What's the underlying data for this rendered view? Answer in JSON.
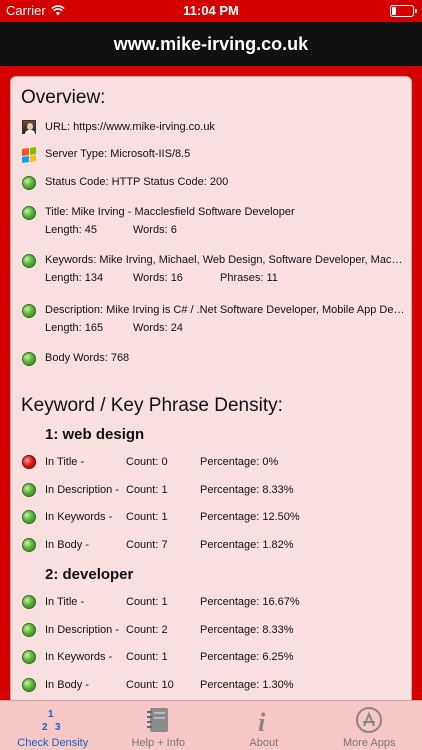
{
  "status_bar": {
    "carrier": "Carrier",
    "time": "11:04 PM",
    "battery_level": 0.22
  },
  "nav": {
    "title": "www.mike-irving.co.uk"
  },
  "overview": {
    "heading": "Overview:",
    "url": "URL: https://www.mike-irving.co.uk",
    "server": "Server Type: Microsoft-IIS/8.5",
    "status": "Status Code: HTTP Status Code: 200",
    "title": {
      "text": "Title: Mike Irving - Macclesfield Software Developer",
      "length": "Length: 45",
      "words": "Words: 6"
    },
    "keywords": {
      "text": "Keywords: Mike Irving, Michael, Web Design, Software Developer, Macclesfield, Cheshire",
      "length": "Length: 134",
      "words": "Words: 16",
      "phrases": "Phrases: 11"
    },
    "description": {
      "text": "Description: Mike Irving is C# / .Net Software Developer, Mobile App Developer in Macclesfield",
      "length": "Length: 165",
      "words": "Words: 24"
    },
    "body_words": "Body Words: 768"
  },
  "density": {
    "heading": "Keyword / Key Phrase Density:",
    "groups": [
      {
        "title": "1: web design",
        "rows": [
          {
            "label": "In Title -",
            "count": "Count: 0",
            "percentage": "Percentage: 0%",
            "status": "red"
          },
          {
            "label": "In Description -",
            "count": "Count: 1",
            "percentage": "Percentage: 8.33%",
            "status": "green"
          },
          {
            "label": "In Keywords -",
            "count": "Count: 1",
            "percentage": "Percentage: 12.50%",
            "status": "green"
          },
          {
            "label": "In Body -",
            "count": "Count: 7",
            "percentage": "Percentage: 1.82%",
            "status": "green"
          }
        ]
      },
      {
        "title": "2: developer",
        "rows": [
          {
            "label": "In Title -",
            "count": "Count: 1",
            "percentage": "Percentage: 16.67%",
            "status": "green"
          },
          {
            "label": "In Description -",
            "count": "Count: 2",
            "percentage": "Percentage: 8.33%",
            "status": "green"
          },
          {
            "label": "In Keywords -",
            "count": "Count: 1",
            "percentage": "Percentage: 6.25%",
            "status": "green"
          },
          {
            "label": "In Body -",
            "count": "Count: 10",
            "percentage": "Percentage: 1.30%",
            "status": "green"
          }
        ]
      }
    ]
  },
  "tabs": [
    {
      "label": "Check Density",
      "icon": "density-icon"
    },
    {
      "label": "Help + Info",
      "icon": "notebook-icon"
    },
    {
      "label": "About",
      "icon": "info-icon"
    },
    {
      "label": "More Apps",
      "icon": "app-store-icon"
    }
  ],
  "colors": {
    "accent": "#d40000",
    "panel": "#f9e0e0",
    "tab_active": "#1565c0",
    "nav": "#111111"
  }
}
